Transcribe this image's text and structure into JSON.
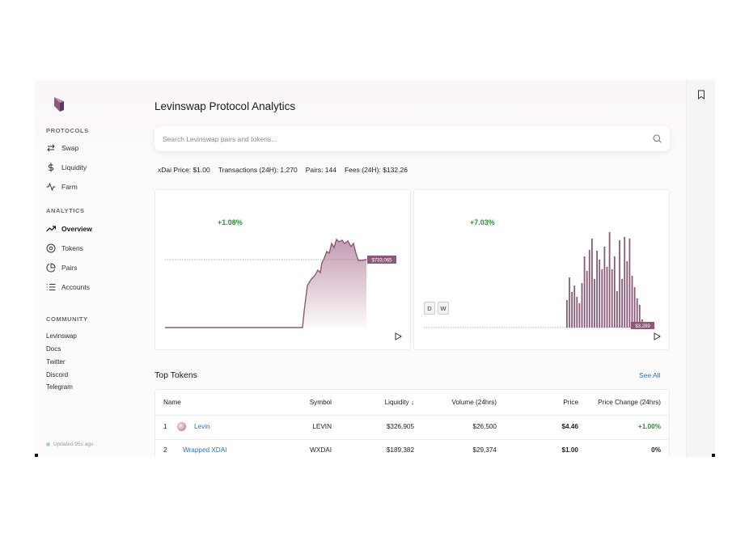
{
  "sidebar": {
    "sections": {
      "protocols": "PROTOCOLS",
      "analytics": "ANALYTICS",
      "community": "COMMUNITY"
    },
    "protocol_items": [
      {
        "label": "Swap",
        "icon": "swap-icon"
      },
      {
        "label": "Liquidity",
        "icon": "dollar-icon"
      },
      {
        "label": "Farm",
        "icon": "activity-icon"
      }
    ],
    "analytics_items": [
      {
        "label": "Overview",
        "icon": "trending-up-icon",
        "active": true
      },
      {
        "label": "Tokens",
        "icon": "disc-icon"
      },
      {
        "label": "Pairs",
        "icon": "pie-chart-icon"
      },
      {
        "label": "Accounts",
        "icon": "list-icon"
      }
    ],
    "community_items": [
      "Levinswap",
      "Docs",
      "Twitter",
      "Discord",
      "Telegram"
    ],
    "updated": "Updated 95s ago"
  },
  "main": {
    "title": "Levinswap Protocol Analytics",
    "search_placeholder": "Search Levinswap pairs and tokens...",
    "stats": {
      "price": "xDai Price: $1.00",
      "transactions": "Transactions (24H): 1,270",
      "pairs": "Pairs: 144",
      "fees": "Fees (24H): $132.26"
    },
    "liquidity_card": {
      "change": "+1.08%",
      "value_label": "$733,065"
    },
    "volume_card": {
      "change": "+7.03%",
      "value_label": "$3,289",
      "toggle_d": "D",
      "toggle_w": "W"
    },
    "top_tokens": {
      "title": "Top Tokens",
      "see_all": "See All",
      "headers": {
        "name": "Name",
        "symbol": "Symbol",
        "liquidity": "Liquidity ↓",
        "volume": "Volume (24hrs)",
        "price": "Price",
        "change": "Price Change (24hrs)"
      },
      "rows": [
        {
          "rank": "1",
          "name": "Levin",
          "symbol": "LEVIN",
          "liquidity": "$326,905",
          "volume": "$26,500",
          "price": "$4.46",
          "change": "+1.00%"
        },
        {
          "rank": "2",
          "name": "Wrapped XDAI",
          "symbol": "WXDAI",
          "liquidity": "$189,382",
          "volume": "$29,374",
          "price": "$1.00",
          "change": "0%"
        }
      ]
    }
  },
  "colors": {
    "accent": "#8c5a76",
    "positive": "#2e8b3a",
    "link": "#2b6fd6"
  }
}
